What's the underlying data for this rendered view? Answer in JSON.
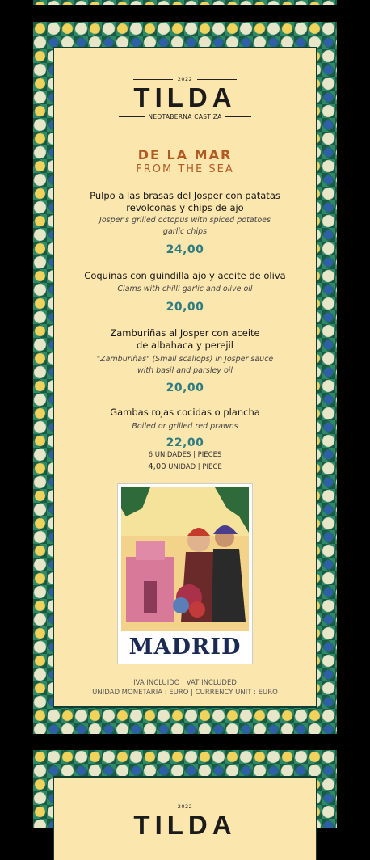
{
  "menu": {
    "year": "2022",
    "brand": "TILDA",
    "subtitle": "NEOTABERNA CASTIZA",
    "section_es": "DE LA MAR",
    "section_en": "FROM THE SEA",
    "items": [
      {
        "name_line1": "Pulpo a las brasas del Josper con patatas",
        "name_line2": "revolconas y chips de ajo",
        "trans_line1": "Josper's grilled octopus with spiced potatoes",
        "trans_line2": "garlic chips",
        "price": "24,00"
      },
      {
        "name_line1": "Coquinas con guindilla ajo y aceite de oliva",
        "trans_line1": "Clams with chilli garlic and olive oil",
        "price": "20,00"
      },
      {
        "name_line1": "Zamburiñas al Josper con aceite",
        "name_line2": "de albahaca y perejil",
        "trans_line1": "\"Zamburiñas\" (Small scallops) in Josper sauce",
        "trans_line2": "with basil and parsley oil",
        "price": "20,00"
      },
      {
        "name_line1": "Gambas rojas cocidas o plancha",
        "trans_line1": "Boiled or grilled red prawns",
        "price": "22,00",
        "units_line1": "6 UNIDADES | PIECES",
        "units_price2": "4,00",
        "units_line2": "UNIDAD | PIECE"
      }
    ],
    "poster_text": "MADRID",
    "footer_line1": "IVA INCLUIDO | VAT INCLUDED",
    "footer_line2": "UNIDAD MONETARIA : EURO | CURRENCY UNIT : EURO"
  },
  "next_page": {
    "year": "2022",
    "brand": "TILDA"
  }
}
